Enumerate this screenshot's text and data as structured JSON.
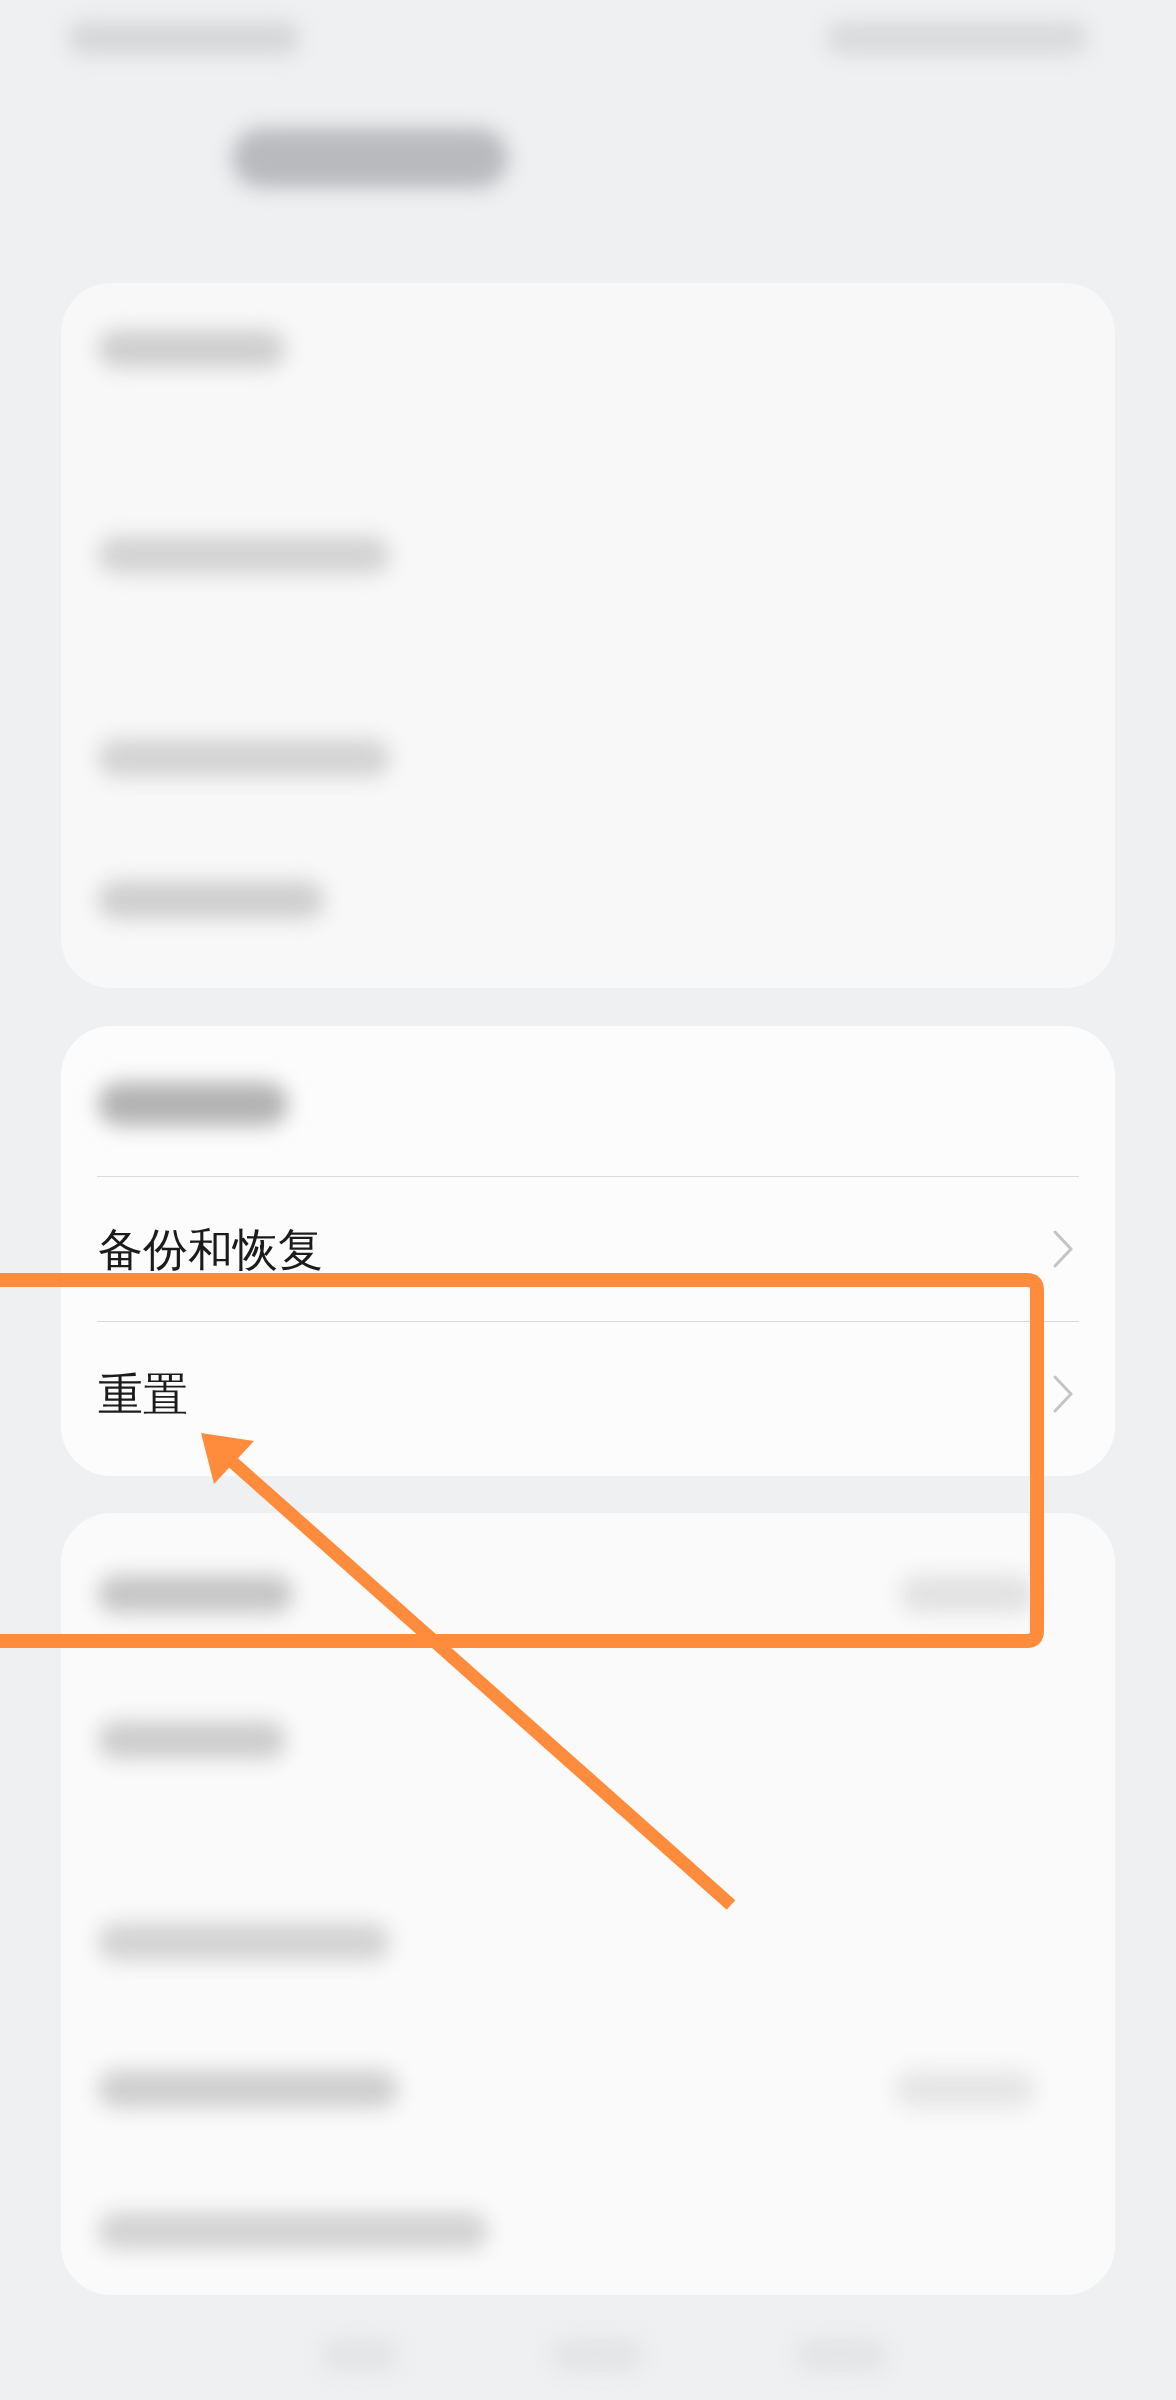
{
  "settings_group": {
    "items": [
      {
        "label": "备份和恢复"
      },
      {
        "label": "重置"
      }
    ]
  }
}
